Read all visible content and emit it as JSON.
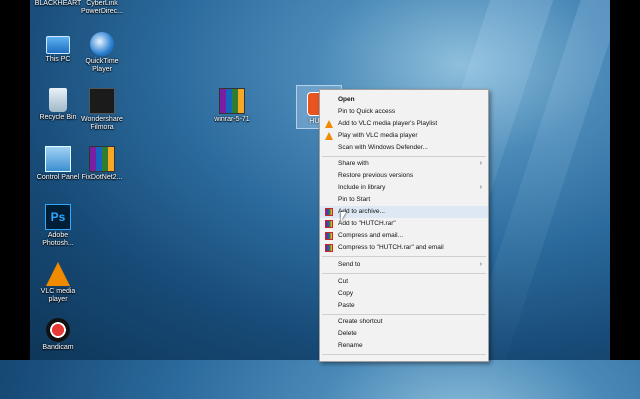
{
  "desktop": {
    "top_labels": [
      "BLACKHEART",
      "CyberLink PowerDirec..."
    ],
    "icons": [
      {
        "id": "this-pc",
        "label": "This PC"
      },
      {
        "id": "quicktime",
        "label": "QuickTime Player"
      },
      {
        "id": "recycle-bin",
        "label": "Recycle Bin"
      },
      {
        "id": "wondershare",
        "label": "Wondershare Filmora"
      },
      {
        "id": "winrar",
        "label": "winrar-5-71"
      },
      {
        "id": "control-panel",
        "label": "Control Panel"
      },
      {
        "id": "fixdotnet",
        "label": "FixDotNet2..."
      },
      {
        "id": "photoshop",
        "label": "Adobe Photosh..."
      },
      {
        "id": "vlc",
        "label": "VLC media player"
      },
      {
        "id": "bandicam",
        "label": "Bandicam"
      }
    ],
    "selected_icon_label": "HUT..."
  },
  "context_menu": {
    "items": [
      {
        "label": "Open",
        "bold": true
      },
      {
        "label": "Pin to Quick access"
      },
      {
        "label": "Add to VLC media player's Playlist",
        "icon": "vlc-icon"
      },
      {
        "label": "Play with VLC media player",
        "icon": "vlc-icon"
      },
      {
        "label": "Scan with Windows Defender..."
      },
      {
        "label": "Share with",
        "submenu": true
      },
      {
        "label": "Restore previous versions"
      },
      {
        "label": "Include in library",
        "submenu": true
      },
      {
        "label": "Pin to Start"
      },
      {
        "label": "Add to archive...",
        "icon": "winrar-icon",
        "hover": true
      },
      {
        "label": "Add to \"HUTCH.rar\"",
        "icon": "winrar-icon"
      },
      {
        "label": "Compress and email...",
        "icon": "winrar-icon"
      },
      {
        "label": "Compress to \"HUTCH.rar\" and email",
        "icon": "winrar-icon"
      },
      {
        "label": "Send to",
        "submenu": true
      },
      {
        "label": "Cut"
      },
      {
        "label": "Copy"
      },
      {
        "label": "Paste"
      },
      {
        "label": "Create shortcut"
      },
      {
        "label": "Delete"
      },
      {
        "label": "Rename"
      }
    ],
    "submenu_arrow": "›"
  }
}
